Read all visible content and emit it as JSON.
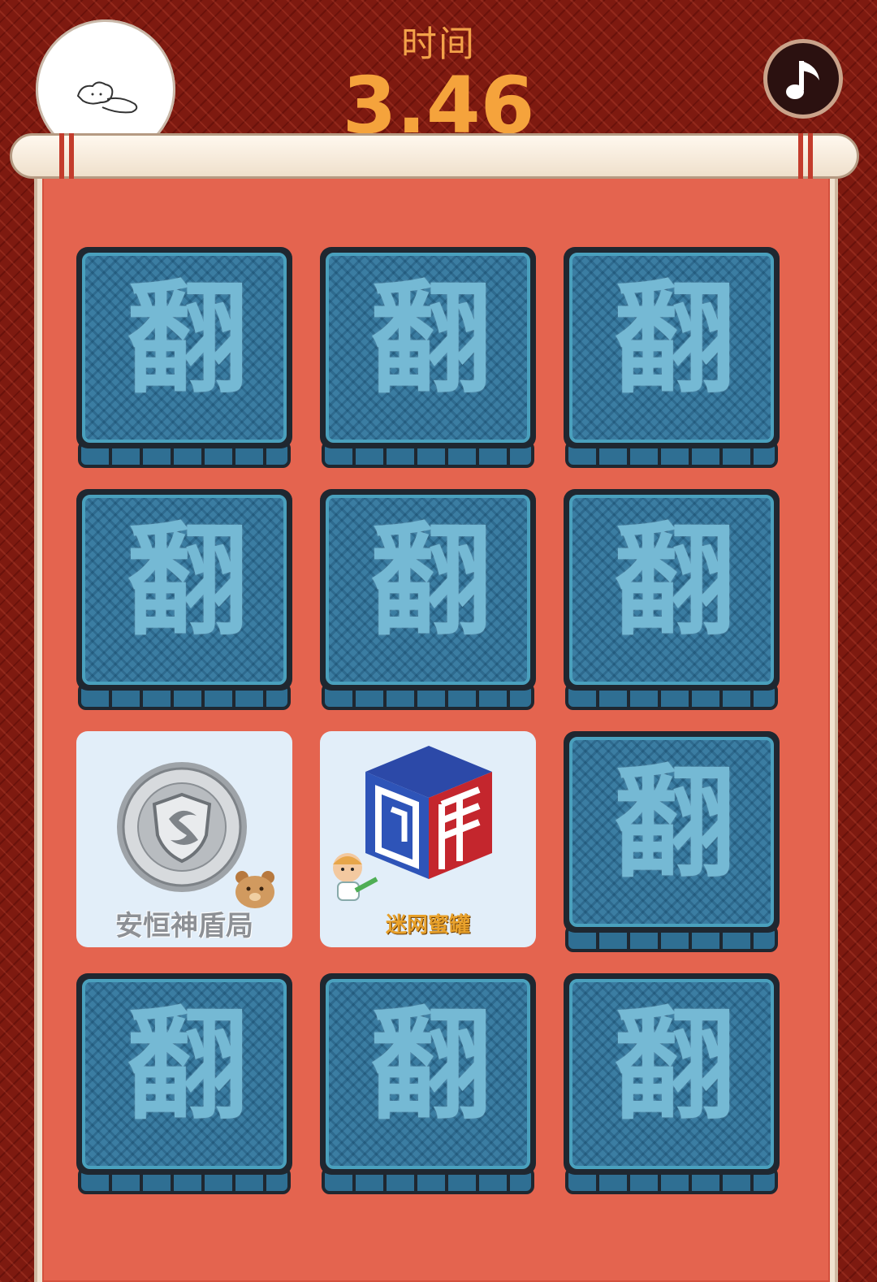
{
  "header": {
    "timer_label": "时间",
    "timer_value": "3.46"
  },
  "icons": {
    "avatar": "sleeping-character-icon",
    "music": "music-note-icon",
    "badge": "shield-badge-icon",
    "cube": "cube-logo-icon",
    "bear": "bear-sticker-icon",
    "kid": "kid-sticker-icon"
  },
  "colors": {
    "timer": "#f5a33c",
    "card_back": "#3b7da2",
    "paper": "#e4644f",
    "background": "#7e1a10"
  },
  "cards": [
    {
      "state": "face-down",
      "glyph": "翻"
    },
    {
      "state": "face-down",
      "glyph": "翻"
    },
    {
      "state": "face-down",
      "glyph": "翻"
    },
    {
      "state": "face-down",
      "glyph": "翻"
    },
    {
      "state": "face-down",
      "glyph": "翻"
    },
    {
      "state": "face-down",
      "glyph": "翻"
    },
    {
      "state": "face-up",
      "caption": "安恒神盾局"
    },
    {
      "state": "face-up",
      "caption": "迷网蜜罐"
    },
    {
      "state": "face-down",
      "glyph": "翻"
    },
    {
      "state": "face-down",
      "glyph": "翻"
    },
    {
      "state": "face-down",
      "glyph": "翻"
    },
    {
      "state": "face-down",
      "glyph": "翻"
    }
  ]
}
